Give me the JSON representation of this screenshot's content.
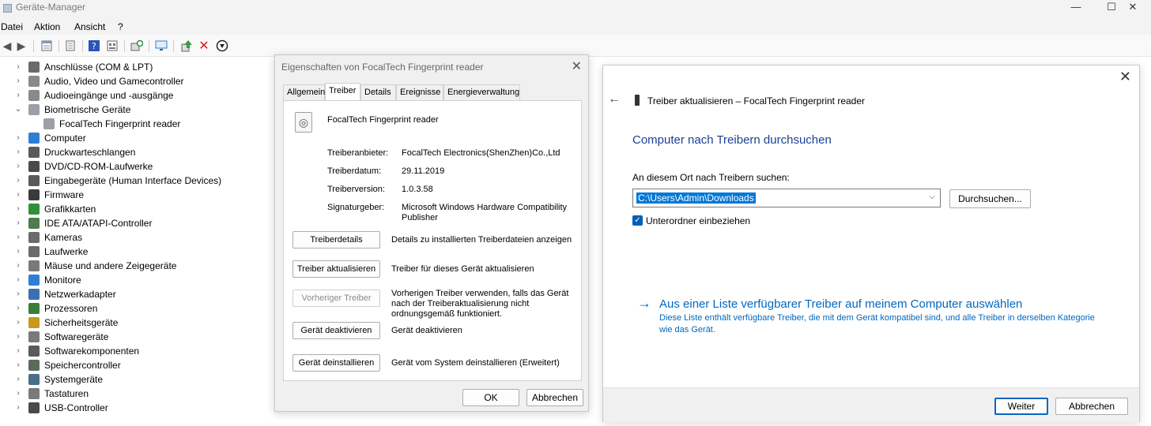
{
  "window": {
    "title": "Geräte-Manager",
    "minimize": "—",
    "maximize": "☐",
    "close": "✕"
  },
  "menu": [
    "Datei",
    "Aktion",
    "Ansicht",
    "?"
  ],
  "tree": [
    {
      "label": "Anschlüsse (COM & LPT)",
      "icon": "port-icon",
      "color": "#6b6b6b"
    },
    {
      "label": "Audio, Video und Gamecontroller",
      "icon": "speaker-icon",
      "color": "#8a8a8a"
    },
    {
      "label": "Audioeingänge und -ausgänge",
      "icon": "speaker-icon",
      "color": "#8a8a8a"
    },
    {
      "label": "Biometrische Geräte",
      "icon": "fingerprint-icon",
      "color": "#9aa0a6",
      "expanded": true
    },
    {
      "label": "FocalTech Fingerprint reader",
      "icon": "fingerprint-icon",
      "color": "#9aa0a6",
      "child": true
    },
    {
      "label": "Computer",
      "icon": "monitor-icon",
      "color": "#2d7fd3"
    },
    {
      "label": "Druckwarteschlangen",
      "icon": "printer-icon",
      "color": "#5a5a5a"
    },
    {
      "label": "DVD/CD-ROM-Laufwerke",
      "icon": "disc-drive-icon",
      "color": "#4a4a4a"
    },
    {
      "label": "Eingabegeräte (Human Interface Devices)",
      "icon": "hid-icon",
      "color": "#5a5a5a"
    },
    {
      "label": "Firmware",
      "icon": "chip-icon",
      "color": "#3a3a3a"
    },
    {
      "label": "Grafikkarten",
      "icon": "display-adapter-icon",
      "color": "#2f8f3a"
    },
    {
      "label": "IDE ATA/ATAPI-Controller",
      "icon": "controller-icon",
      "color": "#4f7a52"
    },
    {
      "label": "Kameras",
      "icon": "camera-icon",
      "color": "#6b6b6b"
    },
    {
      "label": "Laufwerke",
      "icon": "drive-icon",
      "color": "#6b6b6b"
    },
    {
      "label": "Mäuse und andere Zeigegeräte",
      "icon": "mouse-icon",
      "color": "#7a7a7a"
    },
    {
      "label": "Monitore",
      "icon": "monitor-icon",
      "color": "#2d7fd3"
    },
    {
      "label": "Netzwerkadapter",
      "icon": "network-adapter-icon",
      "color": "#3a6fb0"
    },
    {
      "label": "Prozessoren",
      "icon": "processor-icon",
      "color": "#3b7d3b"
    },
    {
      "label": "Sicherheitsgeräte",
      "icon": "key-icon",
      "color": "#c79a1e"
    },
    {
      "label": "Softwaregeräte",
      "icon": "software-device-icon",
      "color": "#7a7a7a"
    },
    {
      "label": "Softwarekomponenten",
      "icon": "puzzle-icon",
      "color": "#5a5a5a"
    },
    {
      "label": "Speichercontroller",
      "icon": "storage-controller-icon",
      "color": "#5a6b5a"
    },
    {
      "label": "Systemgeräte",
      "icon": "system-device-icon",
      "color": "#4a6e8a"
    },
    {
      "label": "Tastaturen",
      "icon": "keyboard-icon",
      "color": "#7a7a7a"
    },
    {
      "label": "USB-Controller",
      "icon": "usb-icon",
      "color": "#4a4a4a"
    }
  ],
  "props": {
    "title": "Eigenschaften von FocalTech Fingerprint reader",
    "close": "✕",
    "tabs": [
      "Allgemein",
      "Treiber",
      "Details",
      "Ereignisse",
      "Energieverwaltung"
    ],
    "device_name": "FocalTech Fingerprint reader",
    "fields": [
      {
        "label": "Treiberanbieter:",
        "value": "FocalTech Electronics(ShenZhen)Co.,Ltd"
      },
      {
        "label": "Treiberdatum:",
        "value": "29.11.2019"
      },
      {
        "label": "Treiberversion:",
        "value": "1.0.3.58"
      },
      {
        "label": "Signaturgeber:",
        "value": "Microsoft Windows Hardware Compatibility Publisher"
      }
    ],
    "actions": [
      {
        "button": "Treiberdetails",
        "desc": "Details zu installierten Treiberdateien anzeigen",
        "disabled": false
      },
      {
        "button": "Treiber aktualisieren",
        "desc": "Treiber für dieses Gerät aktualisieren",
        "disabled": false
      },
      {
        "button": "Vorheriger Treiber",
        "desc": "Vorherigen Treiber verwenden, falls das Gerät nach der Treiberaktualisierung nicht ordnungsgemäß funktioniert.",
        "disabled": true
      },
      {
        "button": "Gerät deaktivieren",
        "desc": "Gerät deaktivieren",
        "disabled": false
      },
      {
        "button": "Gerät deinstallieren",
        "desc": "Gerät vom System deinstallieren (Erweitert)",
        "disabled": false
      }
    ],
    "ok": "OK",
    "cancel": "Abbrechen"
  },
  "update": {
    "close": "✕",
    "back": "←",
    "header": "Treiber aktualisieren – FocalTech Fingerprint reader",
    "heading": "Computer nach Treibern durchsuchen",
    "location_label": "An diesem Ort nach Treibern suchen:",
    "path": "C:\\Users\\Admin\\Downloads",
    "browse": "Durchsuchen...",
    "include_subfolders": "Unterordner einbeziehen",
    "link": "Aus einer Liste verfügbarer Treiber auf meinem Computer auswählen",
    "link_desc": "Diese Liste enthält verfügbare Treiber, die mit dem Gerät kompatibel sind, und alle Treiber in derselben Kategorie wie das Gerät.",
    "next": "Weiter",
    "cancel": "Abbrechen"
  }
}
